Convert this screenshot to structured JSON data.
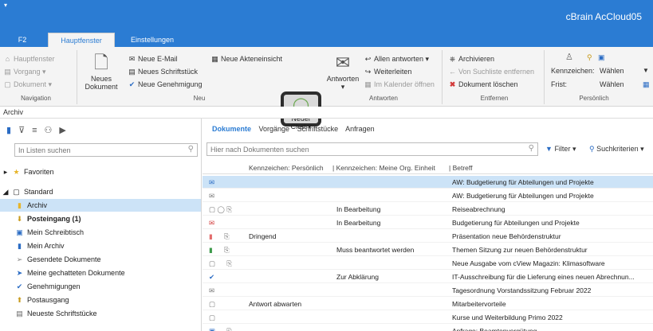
{
  "window": {
    "quick_access": "▾",
    "title": "cBrain AcCloud05"
  },
  "tabs": [
    "F2",
    "Hauptfenster",
    "Einstellungen"
  ],
  "ribbon": {
    "navigation": {
      "label": "Navigation",
      "items": [
        "Hauptfenster",
        "Vorgang",
        "Dokument"
      ]
    },
    "neu": {
      "label": "Neu",
      "neues_dokument_line1": "Neues",
      "neues_dokument_line2": "Dokument",
      "items": [
        "Neue E-Mail",
        "Neues Schriftstück",
        "Neue Genehmigung"
      ],
      "akteneinsicht": "Neue Akteneinsicht",
      "neuer_chat_line1": "Neuer",
      "neuer_chat_line2": "Chat"
    },
    "antworten": {
      "label": "Antworten",
      "big": "Antworten",
      "items": [
        "Allen antworten",
        "Weiterleiten",
        "Im Kalender öffnen"
      ]
    },
    "entfernen": {
      "label": "Entfernen",
      "items": [
        "Archivieren",
        "Von Suchliste entfernen",
        "Dokument löschen"
      ]
    },
    "persoenlich": {
      "label": "Persönlich",
      "kennzeichen": "Kennzeichen:",
      "frist": "Frist:",
      "waehlen1": "Wählen",
      "waehlen2": "Wählen"
    }
  },
  "breadcrumb": "Archiv",
  "left": {
    "search_placeholder": "In Listen suchen",
    "items": [
      "Favoriten",
      "Standard",
      "Archiv",
      "Posteingang (1)",
      "Mein Schreibtisch",
      "Mein Archiv",
      "Gesendete Dokumente",
      "Meine gechatteten Dokumente",
      "Genehmigungen",
      "Postausgang",
      "Neueste Schriftstücke"
    ]
  },
  "right": {
    "tabs": [
      "Dokumente",
      "Vorgänge",
      "Schriftstücke",
      "Anfragen"
    ],
    "search_placeholder": "Hier nach Dokumenten suchen",
    "filter": "Filter",
    "suchkriterien": "Suchkriterien",
    "columns": [
      "Kennzeichen: Persönlich",
      "| Kennzeichen: Meine Org. Einheit",
      "| Betreff"
    ],
    "rows": [
      {
        "flag": "",
        "org": "",
        "subject": "AW: Budgetierung für Abteilungen und Projekte"
      },
      {
        "flag": "",
        "org": "",
        "subject": "AW: Budgetierung für Abteilungen und Projekte"
      },
      {
        "flag": "",
        "org": "In Bearbeitung",
        "subject": "Reiseabrechnung"
      },
      {
        "flag": "",
        "org": "In Bearbeitung",
        "subject": "Budgetierung für Abteilungen und Projekte"
      },
      {
        "flag": "Dringend",
        "org": "",
        "subject": "Präsentation neue Behördenstruktur"
      },
      {
        "flag": "",
        "org": "Muss beantwortet werden",
        "subject": "Themen Sitzung zur neuen Behördenstruktur"
      },
      {
        "flag": "",
        "org": "",
        "subject": "Neue Ausgabe vom cView Magazin: Klimasoftware"
      },
      {
        "flag": "",
        "org": "Zur Abklärung",
        "subject": "IT-Ausschreibung für die Lieferung eines neuen Abrechnun..."
      },
      {
        "flag": "",
        "org": "",
        "subject": "Tagesordnung Vorstandssitzung Februar 2022"
      },
      {
        "flag": "Antwort abwarten",
        "org": "",
        "subject": "Mitarbeitervorteile"
      },
      {
        "flag": "",
        "org": "",
        "subject": "Kurse und Weiterbildung Primo 2022"
      },
      {
        "flag": "",
        "org": "",
        "subject": "Anfrage: Beamtenvergütung"
      }
    ]
  }
}
